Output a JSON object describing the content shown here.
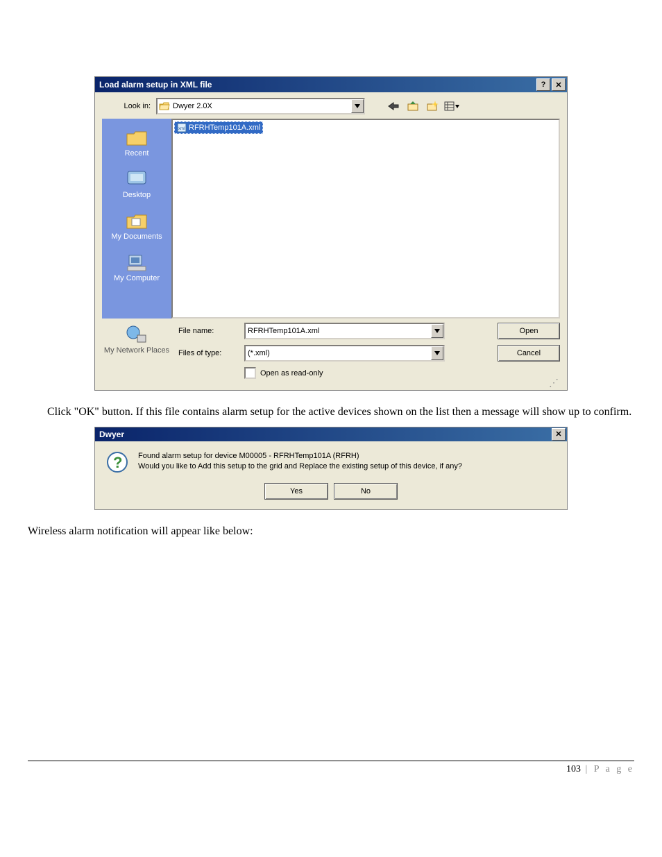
{
  "dialog1": {
    "title": "Load alarm setup in XML file",
    "help_glyph": "?",
    "close_glyph": "✕",
    "lookin_label": "Look in:",
    "lookin_value": "Dwyer 2.0X",
    "places": [
      {
        "label": "Recent",
        "icon": "folder-recent"
      },
      {
        "label": "Desktop",
        "icon": "desktop"
      },
      {
        "label": "My Documents",
        "icon": "my-documents"
      },
      {
        "label": "My Computer",
        "icon": "my-computer"
      },
      {
        "label": "My Network Places",
        "icon": "network-places"
      }
    ],
    "files": [
      {
        "name": "RFRHTemp101A.xml"
      }
    ],
    "filename_label": "File name:",
    "filename_value": "RFRHTemp101A.xml",
    "filetype_label": "Files of type:",
    "filetype_value": "(*.xml)",
    "readonly_label": "Open as read-only",
    "open_btn": "Open",
    "cancel_btn": "Cancel"
  },
  "para1": "Click \"OK\" button. If this file contains alarm setup for the active devices shown on the list then a message will show up to confirm.",
  "msgbox": {
    "title": "Dwyer",
    "line1": "Found alarm setup for device M00005 - RFRHTemp101A (RFRH)",
    "line2": "Would you like to Add this setup to the grid and Replace the existing setup of this device, if any?",
    "yes": "Yes",
    "no": "No",
    "close_glyph": "✕"
  },
  "para2": "Wireless alarm notification will appear like below:",
  "footer": {
    "page_num": "103",
    "page_word": "P a g e"
  }
}
